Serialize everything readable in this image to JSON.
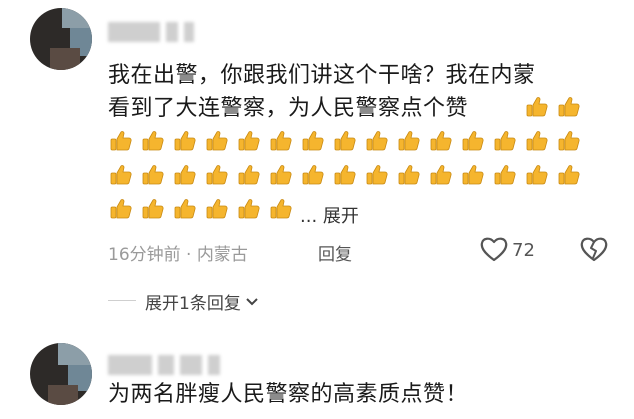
{
  "comment1": {
    "line1": "我在出警，你跟我们讲这个干啥？我在内蒙",
    "line2": "看到了大连警察，为人民警察点个赞",
    "expand_label": "... 展开",
    "time": "16分钟前",
    "location": "内蒙古",
    "reply_label": "回复",
    "like_count": "72",
    "thumbs_rows": [
      2,
      15,
      15,
      6
    ]
  },
  "replies_toggle": {
    "label": "展开1条回复"
  },
  "comment2": {
    "text": "为两名胖瘦人民警察的高素质点赞！"
  },
  "colors": {
    "thumb": "#f5b52e",
    "meta": "#9a9a9a"
  },
  "icons": [
    "heart-icon",
    "broken-heart-icon",
    "thumbs-up-icon",
    "chevron-down-icon"
  ]
}
